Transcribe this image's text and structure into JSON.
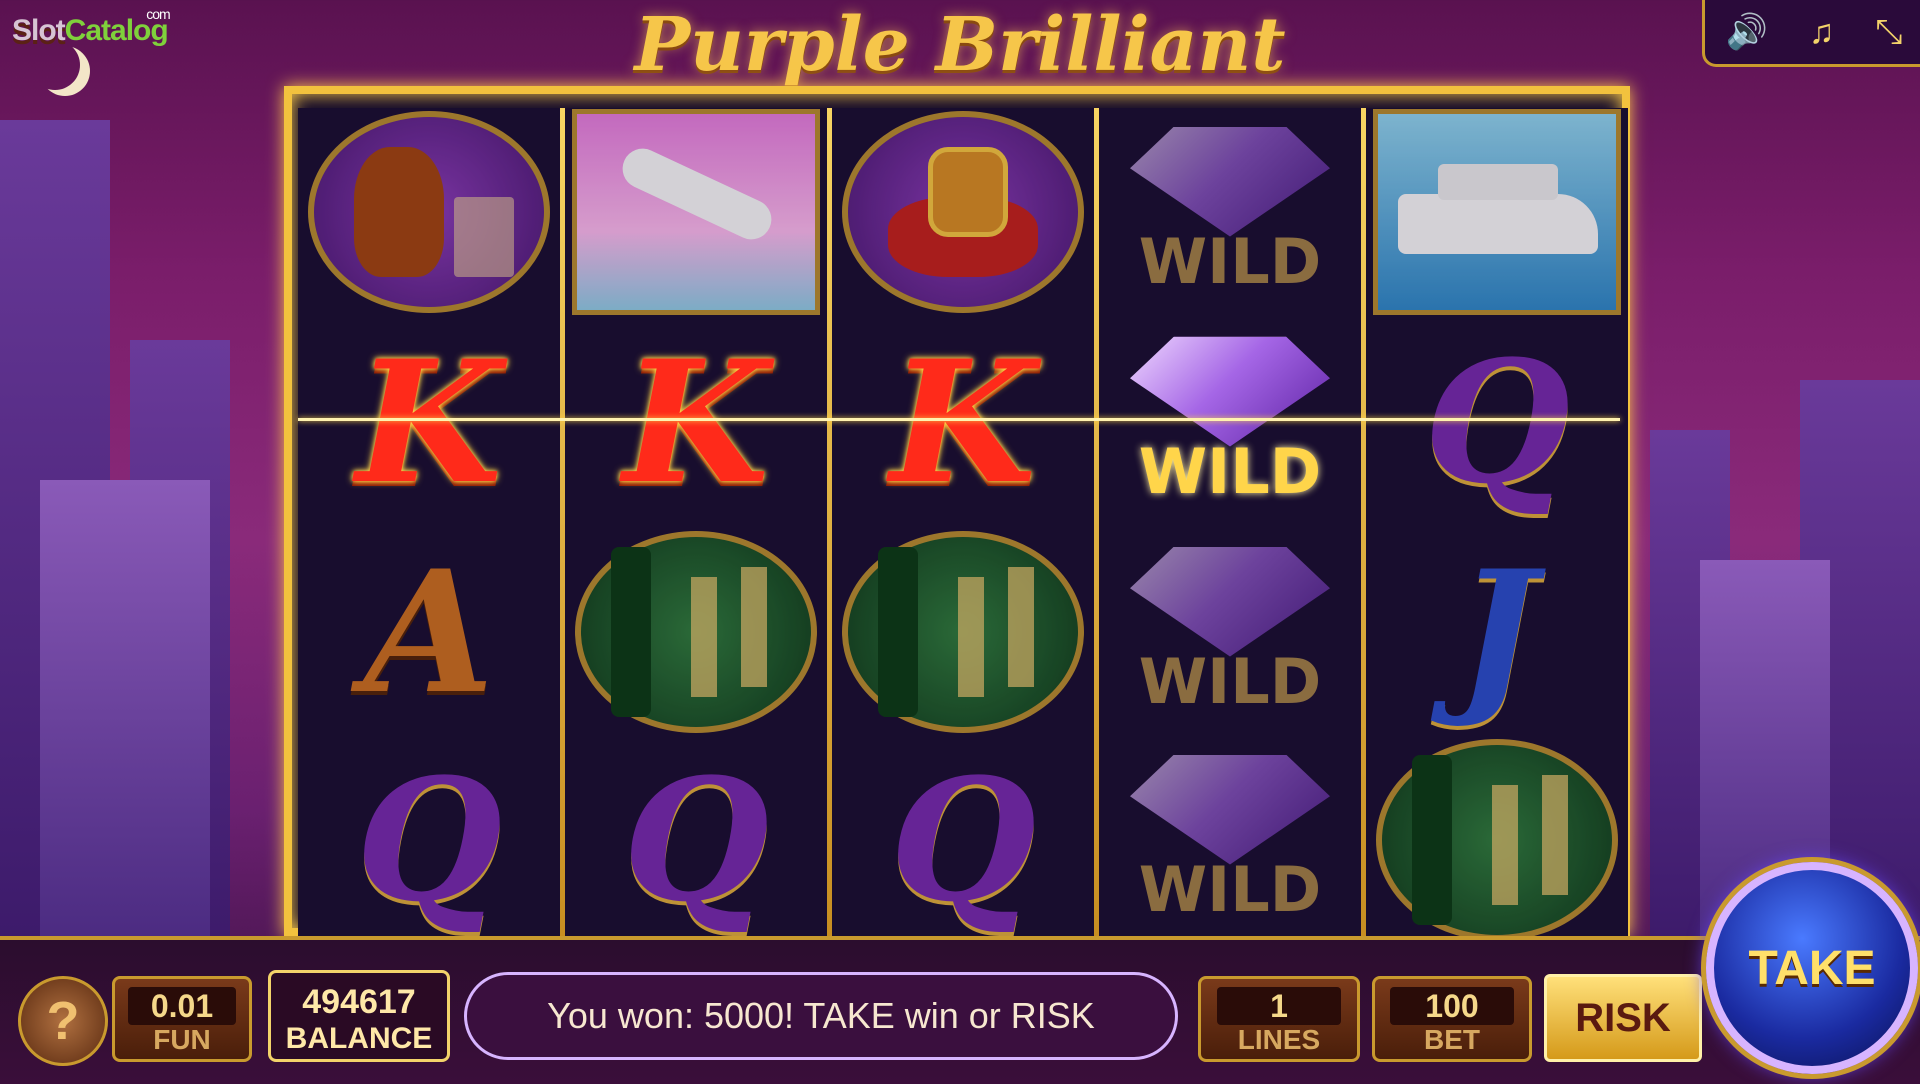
{
  "logo": {
    "part1": "Slot",
    "part2": "Catalog",
    "suffix": "com"
  },
  "game_title": "Purple Brilliant",
  "top_controls": {
    "sound_icon": "speaker-icon",
    "music_icon": "music-note-icon",
    "minimize_icon": "collapse-icon"
  },
  "reels": [
    [
      "cognac",
      "K",
      "A",
      "Q"
    ],
    [
      "jet",
      "K",
      "champagne",
      "Q"
    ],
    [
      "ring",
      "K",
      "champagne",
      "Q"
    ],
    [
      "wild",
      "wild",
      "wild",
      "wild"
    ],
    [
      "yacht",
      "Q",
      "J",
      "champagne"
    ]
  ],
  "symbols": {
    "K": "K",
    "A": "A",
    "Q": "Q",
    "J": "J",
    "wild_text": "WILD"
  },
  "bottom_bar": {
    "help_label": "?",
    "fun_value": "0.01",
    "fun_label": "FUN",
    "balance_value": "494617",
    "balance_label": "BALANCE",
    "message": "You won: 5000! TAKE win or RISK",
    "lines_value": "1",
    "lines_label": "LINES",
    "bet_value": "100",
    "bet_label": "BET",
    "risk_label": "RISK",
    "take_label": "TAKE"
  }
}
